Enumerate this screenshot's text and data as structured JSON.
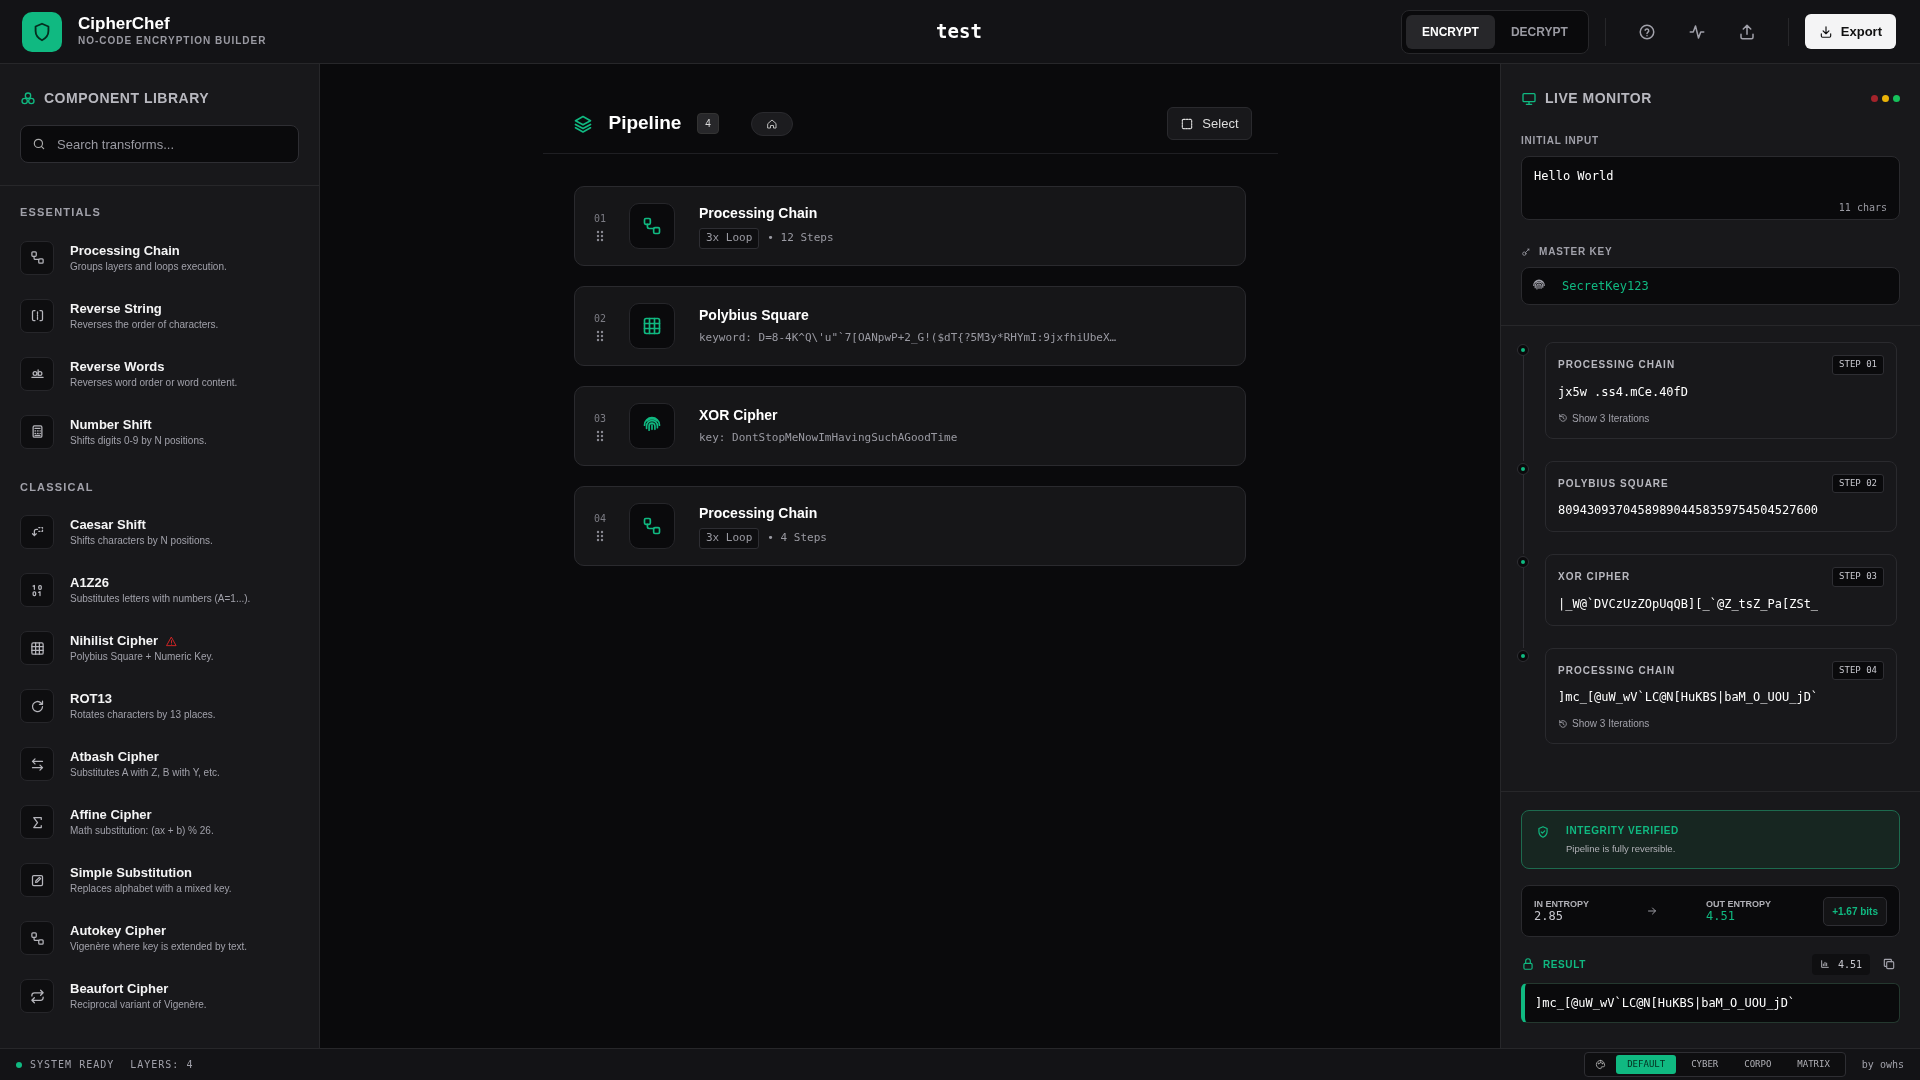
{
  "app": {
    "name": "CipherChef",
    "tagline": "NO-CODE ENCRYPTION BUILDER"
  },
  "document_title": "test",
  "mode_tabs": [
    {
      "label": "ENCRYPT",
      "selected": true
    },
    {
      "label": "DECRYPT",
      "selected": false
    }
  ],
  "export_button": "Export",
  "library": {
    "title": "COMPONENT LIBRARY",
    "search": {
      "placeholder": "Search transforms..."
    },
    "sections": [
      {
        "title": "ESSENTIALS",
        "items": [
          {
            "kind": "chain",
            "name": "Processing Chain",
            "description": "Groups layers and loops execution.",
            "warning": false
          },
          {
            "kind": "reverse",
            "name": "Reverse String",
            "description": "Reverses the order of characters.",
            "warning": false
          },
          {
            "kind": "words",
            "name": "Reverse Words",
            "description": "Reverses word order or word content.",
            "warning": false
          },
          {
            "kind": "calculator",
            "name": "Number Shift",
            "description": "Shifts digits 0-9 by N positions.",
            "warning": false
          }
        ]
      },
      {
        "title": "CLASSICAL",
        "items": [
          {
            "kind": "shift",
            "name": "Caesar Shift",
            "description": "Shifts characters by N positions.",
            "warning": false
          },
          {
            "kind": "binary",
            "name": "A1Z26",
            "description": "Substitutes letters with numbers (A=1...).",
            "warning": false
          },
          {
            "kind": "grid",
            "name": "Nihilist Cipher",
            "description": "Polybius Square + Numeric Key.",
            "warning": true
          },
          {
            "kind": "rotate",
            "name": "ROT13",
            "description": "Rotates characters by 13 places.",
            "warning": false
          },
          {
            "kind": "swap",
            "name": "Atbash Cipher",
            "description": "Substitutes A with Z, B with Y, etc.",
            "warning": false
          },
          {
            "kind": "sigma",
            "name": "Affine Cipher",
            "description": "Math substitution: (ax + b) % 26.",
            "warning": false
          },
          {
            "kind": "edit",
            "name": "Simple Substitution",
            "description": "Replaces alphabet with a mixed key.",
            "warning": false
          },
          {
            "kind": "chain",
            "name": "Autokey Cipher",
            "description": "Vigenère where key is extended by text.",
            "warning": false
          },
          {
            "kind": "repeat",
            "name": "Beaufort Cipher",
            "description": "Reciprocal variant of Vigenère.",
            "warning": false
          }
        ]
      }
    ]
  },
  "pipeline": {
    "title": "Pipeline",
    "count": "4",
    "select_button": "Select",
    "steps": [
      {
        "kind": "chain",
        "number": "01",
        "name": "Processing Chain",
        "loop": "3x Loop",
        "detail": "• 12 Steps"
      },
      {
        "kind": "grid",
        "number": "02",
        "name": "Polybius Square",
        "detail": "keyword: D=8-4K^Q\\'u\"`7[OANpwP+2_G!($dT{?5M3y*RHYmI:9jxfhiUbeX…"
      },
      {
        "kind": "fingerprint",
        "number": "03",
        "name": "XOR Cipher",
        "detail": "key: DontStopMeNowImHavingSuchAGoodTime"
      },
      {
        "kind": "chain",
        "number": "04",
        "name": "Processing Chain",
        "loop": "3x Loop",
        "detail": "• 4 Steps"
      }
    ]
  },
  "monitor": {
    "title": "LIVE MONITOR",
    "dots": [
      {
        "color": "#a3232b"
      },
      {
        "color": "#eab308"
      },
      {
        "color": "#16c15b"
      }
    ],
    "initial_input": {
      "label": "INITIAL INPUT",
      "value": "Hello World",
      "count": "11 chars"
    },
    "master_key": {
      "label": "MASTER KEY",
      "value": "SecretKey123"
    },
    "trace": [
      {
        "title": "PROCESSING CHAIN",
        "step": "STEP 01",
        "output": "jx5w .ss4.mCe.40fD",
        "iterations": "Show 3 Iterations"
      },
      {
        "title": "POLYBIUS SQUARE",
        "step": "STEP 02",
        "output": "809430937045898904458359754504527600"
      },
      {
        "title": "XOR CIPHER",
        "step": "STEP 03",
        "output": "|_W@`DVCzUzZOpUqQB][_`@Z_tsZ_Pa[ZSt_"
      },
      {
        "title": "PROCESSING CHAIN",
        "step": "STEP 04",
        "output": "]mc_[@uW_wV`LC@N[HuKBS|baM_O_UOU_jD`",
        "iterations": "Show 3 Iterations"
      }
    ],
    "integrity": {
      "title": "INTEGRITY VERIFIED",
      "message": "Pipeline is fully reversible."
    },
    "entropy": {
      "in_label": "IN ENTROPY",
      "in_value": "2.85",
      "out_label": "OUT ENTROPY",
      "out_value": "4.51",
      "delta": "+1.67 bits"
    },
    "result": {
      "label": "RESULT",
      "score": "4.51",
      "value": "]mc_[@uW_wV`LC@N[HuKBS|baM_O_UOU_jD`"
    }
  },
  "status_bar": {
    "status": "SYSTEM READY",
    "layers": "LAYERS: 4",
    "themes": [
      {
        "label": "DEFAULT",
        "selected": true
      },
      {
        "label": "CYBER",
        "selected": false
      },
      {
        "label": "CORPO",
        "selected": false
      },
      {
        "label": "MATRIX",
        "selected": false
      }
    ],
    "credit": "by owhs"
  }
}
